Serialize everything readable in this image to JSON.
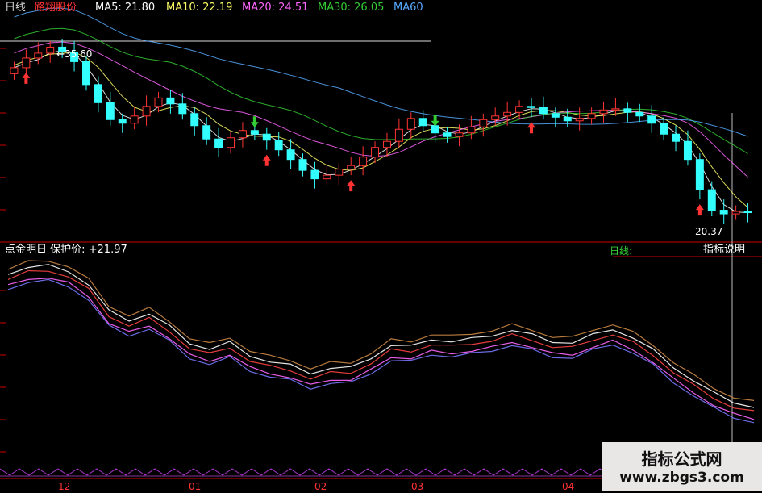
{
  "header": {
    "period": "日线",
    "stock_name": "路翔股份",
    "ma": [
      {
        "label": "MA5: 21.80",
        "color": "#ffffff"
      },
      {
        "label": "MA10: 22.19",
        "color": "#ffff66"
      },
      {
        "label": "MA20: 24.51",
        "color": "#ff66ff"
      },
      {
        "label": "MA30: 26.05",
        "color": "#33cc33"
      },
      {
        "label": "MA60",
        "color": "#55aaff"
      }
    ]
  },
  "indicator": {
    "title": "点金明日 保护价: +21.97",
    "left_stub": "日线:",
    "explain_button": "指标说明"
  },
  "annotations": {
    "high": "35.60",
    "low": "20.37"
  },
  "watermark": {
    "line1": "指标公式网",
    "line2": "www.zbgs3.com"
  },
  "colors": {
    "up": "#ff3333",
    "down": "#33ffff",
    "buy_arrow": "#ff3333",
    "sell_arrow": "#33cc33",
    "grid": "#770000",
    "background": "#000000"
  },
  "chart_data": [
    {
      "type": "candlestick",
      "x_tick_labels": [
        "12",
        "01",
        "02",
        "03",
        "04"
      ],
      "price_annotations": {
        "high": 35.6,
        "low": 20.37
      },
      "close_trend": [
        33.4,
        34.2,
        34.6,
        35.1,
        34.7,
        33.9,
        32.0,
        30.5,
        29.1,
        28.8,
        29.4,
        30.2,
        30.9,
        30.4,
        29.6,
        28.6,
        27.5,
        26.8,
        27.6,
        28.2,
        27.9,
        27.4,
        26.6,
        25.8,
        24.9,
        24.2,
        24.5,
        25.0,
        25.3,
        26.0,
        26.8,
        27.3,
        28.3,
        29.2,
        28.6,
        28.0,
        27.7,
        28.0,
        28.5,
        29.1,
        29.4,
        29.7,
        30.2,
        30.1,
        29.6,
        29.3,
        29.0,
        29.2,
        29.6,
        29.9,
        30.0,
        29.7,
        29.4,
        28.8,
        27.9,
        27.3,
        25.8,
        23.3,
        21.6,
        21.3,
        21.5,
        21.4
      ],
      "buy_signals_index": [
        1,
        21,
        28,
        43,
        57
      ],
      "sell_signals_index": [
        20,
        35
      ]
    },
    {
      "type": "line",
      "series": [
        {
          "values": [
            34.5,
            34.9,
            35.0,
            34.7,
            33.5,
            31.4,
            30.8,
            31.2,
            30.2,
            29.0,
            28.4,
            28.9,
            28.0,
            27.4,
            27.1,
            26.6,
            26.9,
            26.9,
            27.8,
            28.7,
            28.6,
            29.3,
            29.0,
            29.2,
            29.6,
            29.9,
            29.5,
            29.1,
            28.9,
            29.5,
            30.1,
            29.3,
            28.3,
            27.1,
            25.9,
            24.9,
            24.3,
            23.8
          ]
        }
      ]
    }
  ]
}
